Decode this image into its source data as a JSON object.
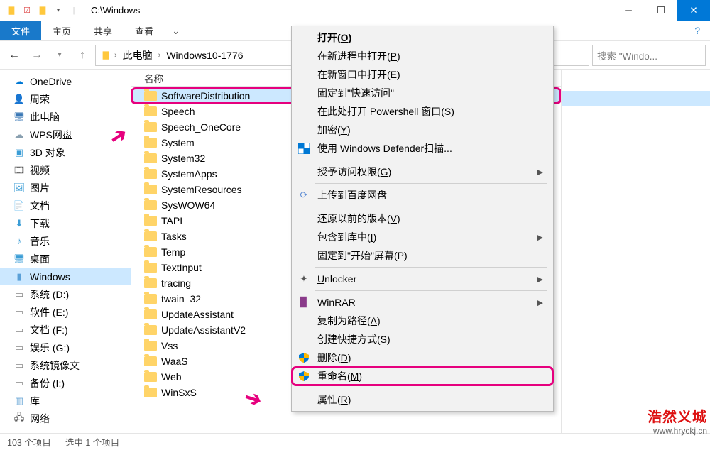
{
  "title": "C:\\Windows",
  "ribbon": {
    "file": "文件",
    "home": "主页",
    "share": "共享",
    "view": "查看"
  },
  "breadcrumb": {
    "pc": "此电脑",
    "drive": "Windows10-1776"
  },
  "search_placeholder": "搜索 \"Windo...",
  "list_header": "名称",
  "tree": [
    {
      "label": "OneDrive",
      "icon": "☁",
      "color": "#0078d4"
    },
    {
      "label": "周荣",
      "icon": "👤",
      "color": "#e8a33d"
    },
    {
      "label": "此电脑",
      "icon": "🖥",
      "color": "#3b78b5"
    },
    {
      "label": "WPS网盘",
      "icon": "☁",
      "color": "#8aa0b0"
    },
    {
      "label": "3D 对象",
      "icon": "▣",
      "color": "#3b9dd6"
    },
    {
      "label": "视频",
      "icon": "🎞",
      "color": "#555"
    },
    {
      "label": "图片",
      "icon": "🖼",
      "color": "#3b9dd6"
    },
    {
      "label": "文档",
      "icon": "📄",
      "color": "#555"
    },
    {
      "label": "下载",
      "icon": "⬇",
      "color": "#3b9dd6"
    },
    {
      "label": "音乐",
      "icon": "♪",
      "color": "#3b9dd6"
    },
    {
      "label": "桌面",
      "icon": "🖥",
      "color": "#3b9dd6"
    },
    {
      "label": "Windows",
      "icon": "▮",
      "color": "#5aa0d8",
      "selected": true
    },
    {
      "label": "系统 (D:)",
      "icon": "▭",
      "color": "#888"
    },
    {
      "label": "软件 (E:)",
      "icon": "▭",
      "color": "#888"
    },
    {
      "label": "文档 (F:)",
      "icon": "▭",
      "color": "#888"
    },
    {
      "label": "娱乐 (G:)",
      "icon": "▭",
      "color": "#888"
    },
    {
      "label": "系统镜像文",
      "icon": "▭",
      "color": "#888"
    },
    {
      "label": "备份 (I:)",
      "icon": "▭",
      "color": "#888"
    },
    {
      "label": "库",
      "icon": "▥",
      "color": "#6aa7d6"
    },
    {
      "label": "网络",
      "icon": "🖧",
      "color": "#555"
    }
  ],
  "files": [
    {
      "name": "SoftwareDistribution",
      "selected": true
    },
    {
      "name": "Speech"
    },
    {
      "name": "Speech_OneCore"
    },
    {
      "name": "System"
    },
    {
      "name": "System32"
    },
    {
      "name": "SystemApps"
    },
    {
      "name": "SystemResources"
    },
    {
      "name": "SysWOW64"
    },
    {
      "name": "TAPI"
    },
    {
      "name": "Tasks"
    },
    {
      "name": "Temp"
    },
    {
      "name": "TextInput"
    },
    {
      "name": "tracing"
    },
    {
      "name": "twain_32"
    },
    {
      "name": "UpdateAssistant"
    },
    {
      "name": "UpdateAssistantV2"
    },
    {
      "name": "Vss"
    },
    {
      "name": "WaaS"
    },
    {
      "name": "Web"
    },
    {
      "name": "WinSxS"
    }
  ],
  "context_menu": [
    {
      "type": "item",
      "label": "打开",
      "accel": "O",
      "bold": true
    },
    {
      "type": "item",
      "label": "在新进程中打开",
      "accel": "P"
    },
    {
      "type": "item",
      "label": "在新窗口中打开",
      "accel": "E"
    },
    {
      "type": "item",
      "label": "固定到\"快速访问\""
    },
    {
      "type": "item",
      "label": "在此处打开 Powershell 窗口",
      "accel": "S"
    },
    {
      "type": "item",
      "label": "加密",
      "accel": "Y"
    },
    {
      "type": "item",
      "label": "使用 Windows Defender扫描...",
      "icon": "defender"
    },
    {
      "type": "sep"
    },
    {
      "type": "item",
      "label": "授予访问权限",
      "accel": "G",
      "submenu": true
    },
    {
      "type": "sep"
    },
    {
      "type": "item",
      "label": "上传到百度网盘",
      "icon": "baidu"
    },
    {
      "type": "sep"
    },
    {
      "type": "item",
      "label": "还原以前的版本",
      "accel": "V"
    },
    {
      "type": "item",
      "label": "包含到库中",
      "accel": "I",
      "submenu": true
    },
    {
      "type": "item",
      "label": "固定到\"开始\"屏幕",
      "accel": "P"
    },
    {
      "type": "sep"
    },
    {
      "type": "item",
      "label": "Unlocker",
      "icon": "unlocker",
      "accel_first": "U",
      "submenu": true
    },
    {
      "type": "sep"
    },
    {
      "type": "item",
      "label": "WinRAR",
      "icon": "winrar",
      "accel_first": "W",
      "submenu": true
    },
    {
      "type": "item",
      "label": "复制为路径",
      "accel": "A"
    },
    {
      "type": "item",
      "label": "创建快捷方式",
      "accel": "S"
    },
    {
      "type": "item",
      "label": "删除",
      "accel": "D",
      "icon": "shield"
    },
    {
      "type": "item",
      "label": "重命名",
      "accel": "M",
      "icon": "shield",
      "highlighted": true
    },
    {
      "type": "sep"
    },
    {
      "type": "item",
      "label": "属性",
      "accel": "R"
    }
  ],
  "status": {
    "count": "103 个项目",
    "selected": "选中 1 个项目"
  },
  "watermark": {
    "chars": "浩然义城",
    "url": "www.hryckj.cn"
  }
}
